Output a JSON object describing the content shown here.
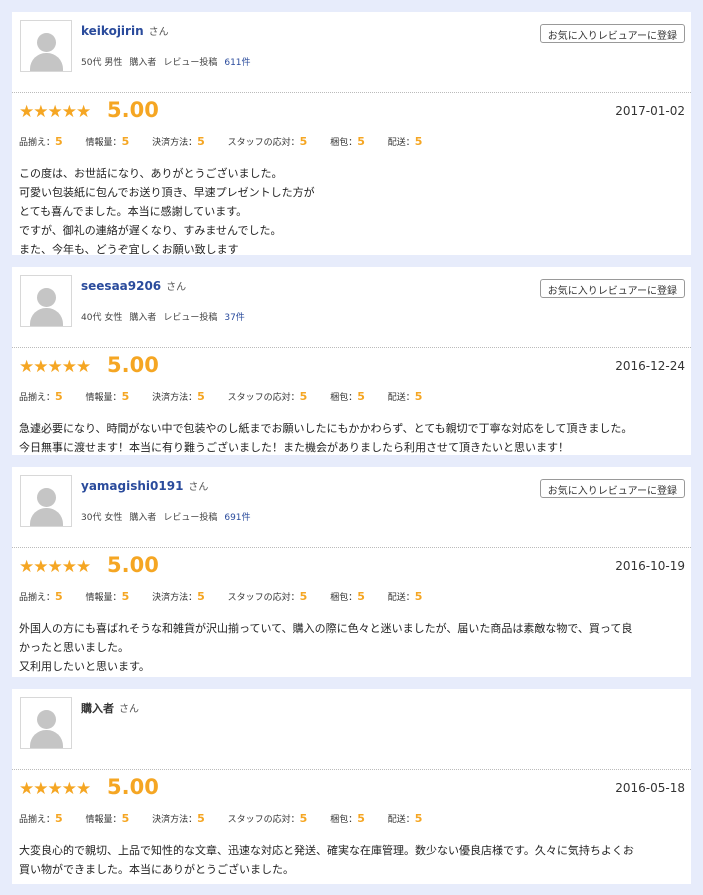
{
  "labels": {
    "san": "さん",
    "fav": "お気に入りレビュアーに登録",
    "buyer": "購入者",
    "review_count": "レビュー投稿",
    "rating_names": [
      "品揃え：",
      "情報量：",
      "決済方法：",
      "スタッフの応対：",
      "梱包：",
      "配送："
    ]
  },
  "colors": {
    "accent": "#f5a623",
    "link": "#2a4b9c",
    "background": "#e7ecfb"
  },
  "reviews": [
    {
      "username": "keikojirin",
      "age_gender": "50代 男性",
      "count": "611件",
      "stars": "★★★★★",
      "score": "5.00",
      "date": "2017-01-02",
      "ratings": [
        "5",
        "5",
        "5",
        "5",
        "5",
        "5"
      ],
      "lines": [
        "この度は、お世話になり、ありがとうございました。",
        "可愛い包装紙に包んでお送り頂き、早速プレゼントした方が",
        "とても喜んでました。本当に感謝しています。",
        "ですが、御礼の連絡が遅くなり、すみませんでした。",
        "また、今年も、どうぞ宜しくお願い致します"
      ]
    },
    {
      "username": "seesaa9206",
      "age_gender": "40代 女性",
      "count": "37件",
      "stars": "★★★★★",
      "score": "5.00",
      "date": "2016-12-24",
      "ratings": [
        "5",
        "5",
        "5",
        "5",
        "5",
        "5"
      ],
      "lines": [
        "急遽必要になり、時間がない中で包装やのし紙までお願いしたにもかかわらず、とても親切で丁寧な対応をして頂きました。",
        "今日無事に渡せます！本当に有り難うございました！また機会がありましたら利用させて頂きたいと思います！"
      ]
    },
    {
      "username": "yamagishi0191",
      "age_gender": "30代 女性",
      "count": "691件",
      "stars": "★★★★★",
      "score": "5.00",
      "date": "2016-10-19",
      "ratings": [
        "5",
        "5",
        "5",
        "5",
        "5",
        "5"
      ],
      "lines": [
        "外国人の方にも喜ばれそうな和雑貨が沢山揃っていて、購入の際に色々と迷いましたが、届いた商品は素敵な物で、買って良",
        "かったと思いました。",
        "又利用したいと思います。"
      ]
    },
    {
      "username": "購入者",
      "stars": "★★★★★",
      "score": "5.00",
      "date": "2016-05-18",
      "ratings": [
        "5",
        "5",
        "5",
        "5",
        "5",
        "5"
      ],
      "lines": [
        "大変良心的で親切、上品で知性的な文章、迅速な対応と発送、確実な在庫管理。数少ない優良店様です。久々に気持ちよくお",
        "買い物ができました。本当にありがとうございました。"
      ]
    }
  ]
}
